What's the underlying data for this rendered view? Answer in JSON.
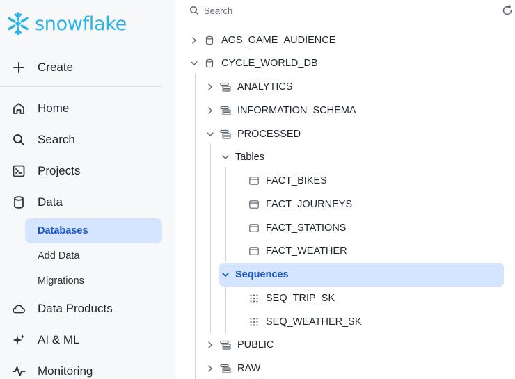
{
  "brand": {
    "name": "snowflake",
    "color": "#29b5e8"
  },
  "sidebar": {
    "create_label": "Create",
    "nav": [
      {
        "label": "Home",
        "icon": "home-icon"
      },
      {
        "label": "Search",
        "icon": "search-icon"
      },
      {
        "label": "Projects",
        "icon": "terminal-icon"
      },
      {
        "label": "Data",
        "icon": "database-icon"
      }
    ],
    "data_sub": [
      {
        "label": "Databases",
        "active": true
      },
      {
        "label": "Add Data",
        "active": false
      },
      {
        "label": "Migrations",
        "active": false
      }
    ],
    "nav_bottom": [
      {
        "label": "Data Products",
        "icon": "cloud-icon"
      },
      {
        "label": "AI & ML",
        "icon": "sparkle-icon"
      },
      {
        "label": "Monitoring",
        "icon": "activity-icon"
      }
    ]
  },
  "main": {
    "search_placeholder": "Search",
    "tree": {
      "db1": "AGS_GAME_AUDIENCE",
      "db2": "CYCLE_WORLD_DB",
      "schema_analytics": "ANALYTICS",
      "schema_info": "INFORMATION_SCHEMA",
      "schema_processed": "PROCESSED",
      "group_tables": "Tables",
      "tables": [
        "FACT_BIKES",
        "FACT_JOURNEYS",
        "FACT_STATIONS",
        "FACT_WEATHER"
      ],
      "group_sequences": "Sequences",
      "sequences": [
        "SEQ_TRIP_SK",
        "SEQ_WEATHER_SK"
      ],
      "schema_public": "PUBLIC",
      "schema_raw": "RAW"
    }
  },
  "colors": {
    "selection": "#d6e5ff",
    "accent": "#1a56c4"
  }
}
